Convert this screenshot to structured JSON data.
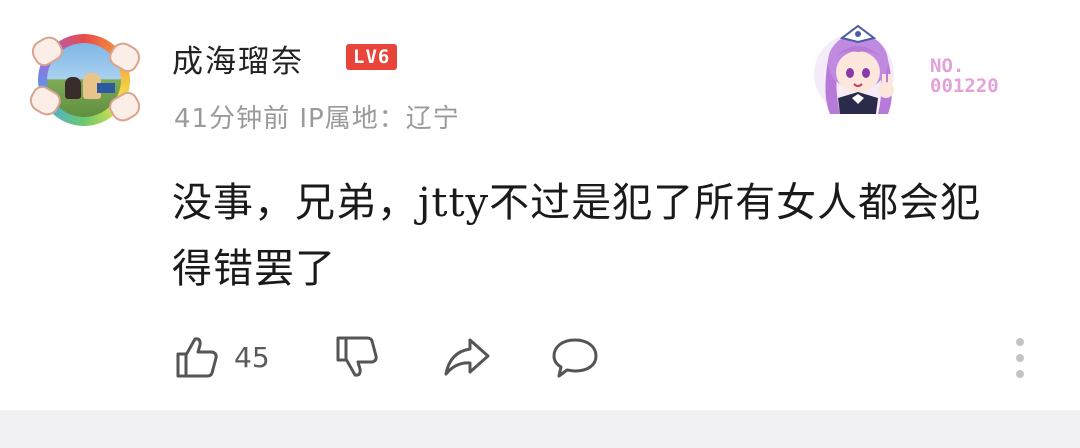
{
  "comment": {
    "username": "成海瑠奈",
    "level": "LV6",
    "meta": "41分钟前 IP属地：辽宁",
    "text": "没事，兄弟，jtty不过是犯了所有女人都会犯得错罢了",
    "decoration_number_line1": "NO.",
    "decoration_number_line2": "001220"
  },
  "actions": {
    "like_count": "45",
    "icons": [
      "thumbs-up-icon",
      "thumbs-down-icon",
      "share-icon",
      "comment-icon",
      "more-icon"
    ]
  },
  "colors": {
    "level_badge": "#e8443a",
    "meta_text": "#9a9a9a",
    "decoration_number": "#e3a1d8",
    "bottom_strip": "#f1f1f3"
  }
}
